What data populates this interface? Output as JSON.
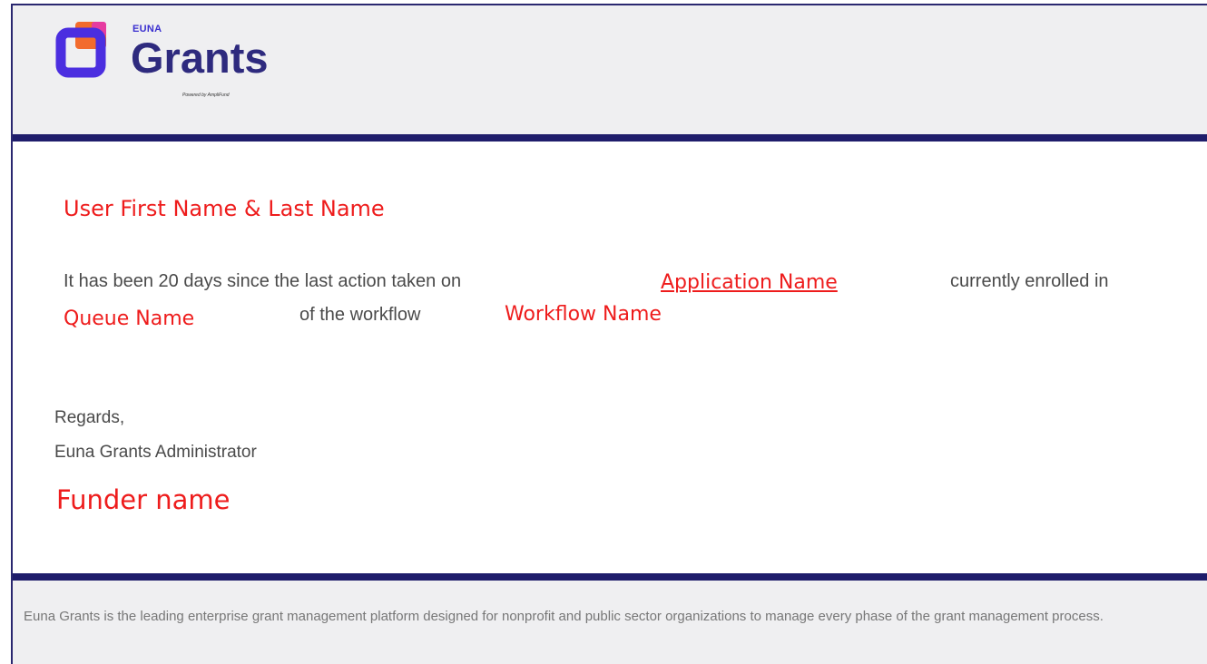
{
  "header": {
    "logo_brand": "EUNA",
    "logo_product": "Grants",
    "logo_tagline": "Powered by AmpliFund"
  },
  "email": {
    "recipient_name": "User First Name & Last Name",
    "body_prefix": "It has been 20 days since the last action taken on",
    "application_name": "Application Name",
    "body_middle": "currently enrolled in",
    "queue_name": "Queue Name",
    "body_of_workflow": "of the workflow",
    "workflow_name": "Workflow Name",
    "regards": "Regards,",
    "signature": "Euna Grants Administrator",
    "funder_name": "Funder name"
  },
  "footer": {
    "text": "Euna Grants is the leading enterprise grant management platform designed for nonprofit and public sector organizations to manage every phase of the grant management process."
  },
  "colors": {
    "accent_navy": "#1f1d6b",
    "placeholder_red": "#ee1c1c",
    "logo_purple": "#4b2ee0",
    "logo_orange": "#f26b2d"
  }
}
